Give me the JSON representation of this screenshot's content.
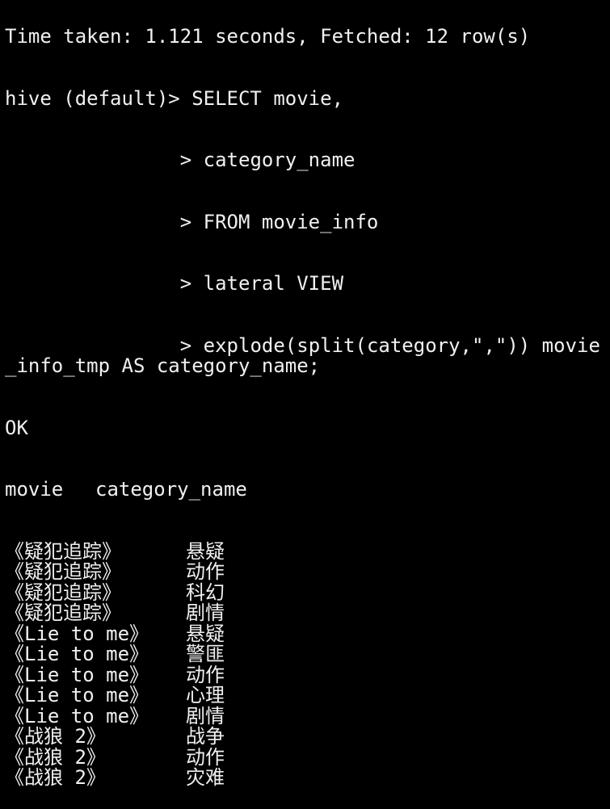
{
  "terminal": {
    "status_line": "Time taken: 1.121 seconds, Fetched: 12 row(s)",
    "prompt": "hive (default)> ",
    "continuation_prompt": "               > ",
    "query_lines": [
      "SELECT movie,",
      "category_name",
      "FROM movie_info",
      "lateral VIEW",
      "explode(split(category,\",\")) movie_info_tmp AS category_name;"
    ],
    "ok": "OK",
    "headers": [
      "movie",
      "category_name"
    ],
    "rows": [
      [
        "《疑犯追踪》",
        "悬疑"
      ],
      [
        "《疑犯追踪》",
        "动作"
      ],
      [
        "《疑犯追踪》",
        "科幻"
      ],
      [
        "《疑犯追踪》",
        "剧情"
      ],
      [
        "《Lie to me》",
        "悬疑"
      ],
      [
        "《Lie to me》",
        "警匪"
      ],
      [
        "《Lie to me》",
        "动作"
      ],
      [
        "《Lie to me》",
        "心理"
      ],
      [
        "《Lie to me》",
        "剧情"
      ],
      [
        "《战狼 2》",
        "战争"
      ],
      [
        "《战狼 2》",
        "动作"
      ],
      [
        "《战狼 2》",
        "灾难"
      ]
    ]
  }
}
